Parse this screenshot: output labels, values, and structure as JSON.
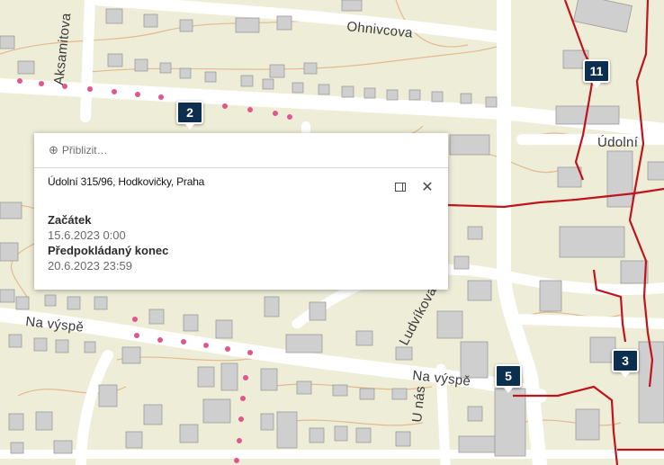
{
  "map": {
    "streets": [
      "Ohnivcova",
      "Aksamitova",
      "Na výspě",
      "Na výspě",
      "Ludvíkova",
      "Údolní",
      "U nás"
    ],
    "markers": [
      "2",
      "11",
      "3",
      "5"
    ],
    "colors": {
      "land": "#eeeed8",
      "building": "#cfcfcf",
      "road": "#ffffff",
      "route_red": "#c0141c",
      "dots_pink": "#e2568d",
      "contour": "#e3b98f",
      "marker_bg": "#0d2f4f"
    }
  },
  "popup": {
    "zoom_label": "Přiblizit…",
    "zoom_icon": "zoom-in-icon",
    "title": "Údolní 315/96, Hodkovičky, Praha",
    "fields": [
      {
        "label": "Začátek",
        "value": "15.6.2023 0:00"
      },
      {
        "label": "Předpokládaný konec",
        "value": "20.6.2023 23:59"
      }
    ]
  }
}
